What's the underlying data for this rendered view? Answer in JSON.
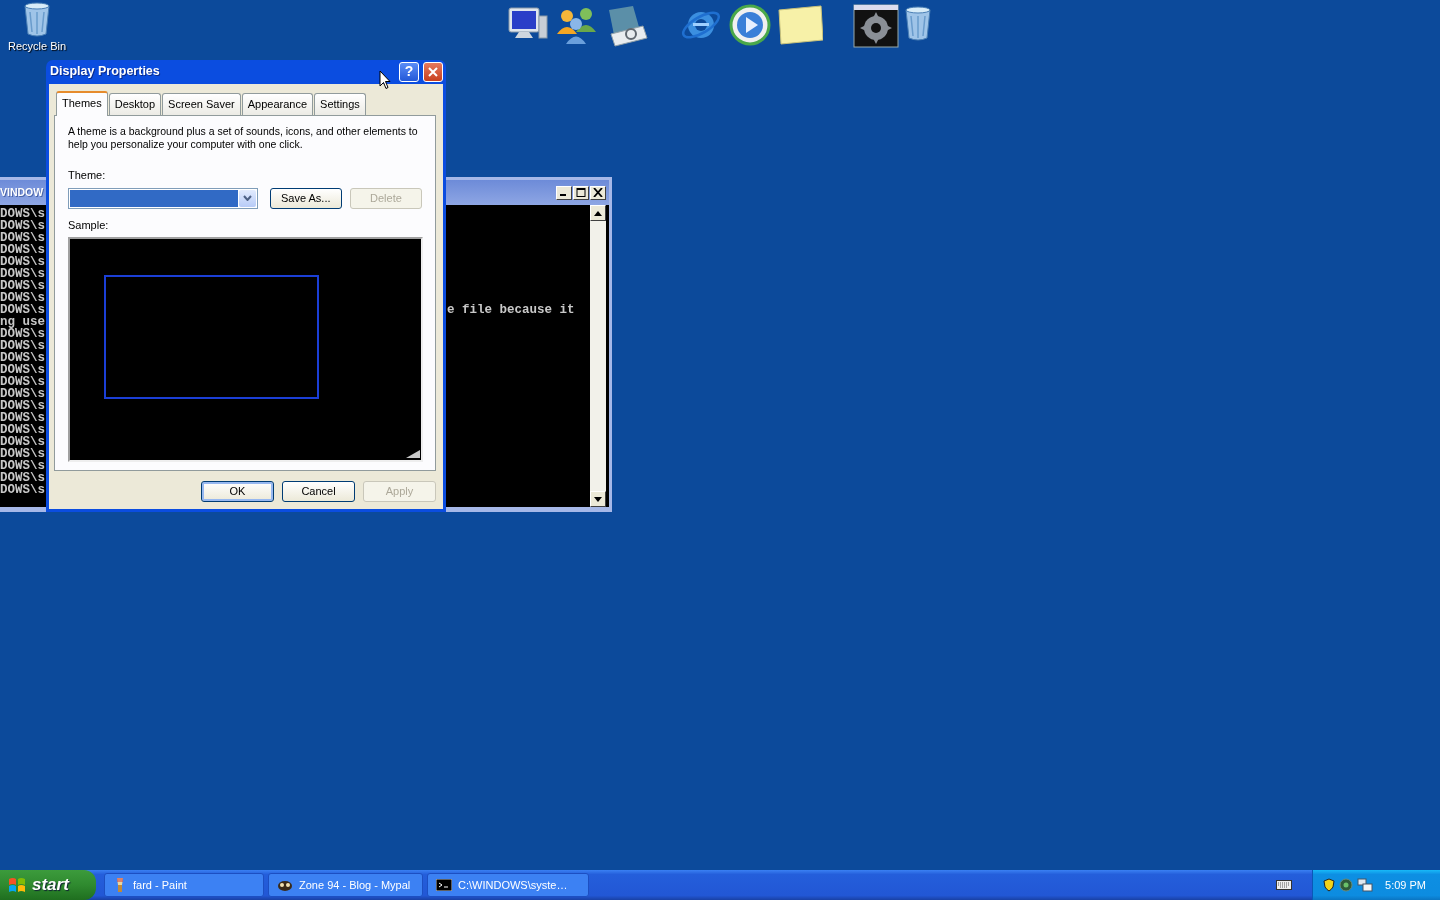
{
  "desktop_icons": [
    {
      "label": "Recycle Bin"
    }
  ],
  "console_window": {
    "title": "VINDOW",
    "lines": [
      {
        "left": "DOWS\\s"
      },
      {
        "left": "DOWS\\s"
      },
      {
        "left": "DOWS\\s"
      },
      {
        "left": "DOWS\\s"
      },
      {
        "left": "DOWS\\s"
      },
      {
        "left": "DOWS\\s"
      },
      {
        "left": "DOWS\\s"
      },
      {
        "left": "DOWS\\s"
      },
      {
        "left": "DOWS\\s",
        "right": "e file because it"
      },
      {
        "left": "ng use"
      },
      {
        "left": "DOWS\\s"
      },
      {
        "left": "DOWS\\s"
      },
      {
        "left": "DOWS\\s"
      },
      {
        "left": "DOWS\\s"
      },
      {
        "left": "DOWS\\s"
      },
      {
        "left": "DOWS\\s"
      },
      {
        "left": "DOWS\\s"
      },
      {
        "left": "DOWS\\s"
      },
      {
        "left": "DOWS\\s"
      },
      {
        "left": "DOWS\\s"
      },
      {
        "left": "DOWS\\s"
      },
      {
        "left": "DOWS\\s"
      },
      {
        "left": "DOWS\\s"
      },
      {
        "left": "DOWS\\s"
      }
    ]
  },
  "dialog": {
    "title": "Display Properties",
    "help": "?",
    "tabs": [
      {
        "label": "Themes",
        "selected": true
      },
      {
        "label": "Desktop",
        "selected": false
      },
      {
        "label": "Screen Saver",
        "selected": false
      },
      {
        "label": "Appearance",
        "selected": false
      },
      {
        "label": "Settings",
        "selected": false
      }
    ],
    "description": "A theme is a background plus a set of sounds, icons, and other elements to help you personalize your computer with one click.",
    "theme_label": "Theme:",
    "theme_buttons": [
      {
        "label": "Save As...",
        "disabled": false
      },
      {
        "label": "Delete",
        "disabled": true
      }
    ],
    "sample_label": "Sample:",
    "buttons": [
      {
        "label": "OK",
        "default": true,
        "disabled": false
      },
      {
        "label": "Cancel",
        "default": false,
        "disabled": false
      },
      {
        "label": "Apply",
        "default": false,
        "disabled": true
      }
    ]
  },
  "taskbar": {
    "start": "start",
    "tasks": [
      {
        "label": "fard - Paint",
        "kind": "paint",
        "selected": false
      },
      {
        "label": "Zone 94 - Blog - Mypal",
        "kind": "browser",
        "selected": false
      },
      {
        "label": "C:\\WINDOWS\\syste…",
        "kind": "console",
        "selected": false
      }
    ],
    "clock": "5:09 PM"
  }
}
